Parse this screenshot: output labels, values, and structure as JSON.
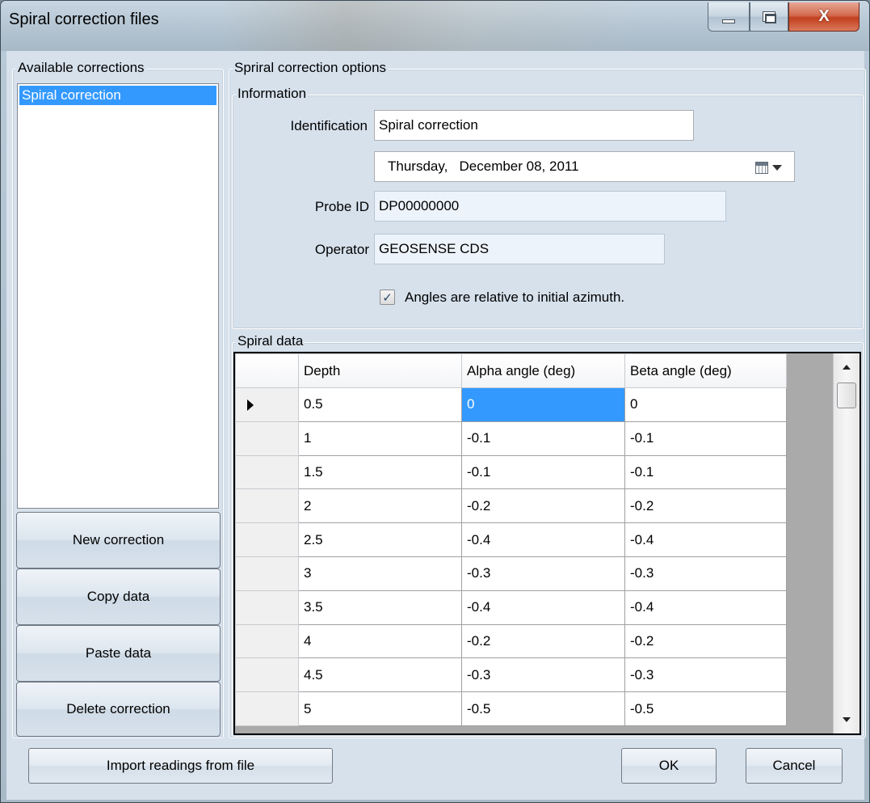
{
  "window": {
    "title": "Spiral correction files",
    "close_glyph": "X"
  },
  "left": {
    "group_label": "Available corrections",
    "items": [
      "Spiral correction"
    ],
    "buttons": {
      "new": "New correction",
      "copy": "Copy data",
      "paste": "Paste data",
      "delete": "Delete correction"
    }
  },
  "options": {
    "group_label": "Spriral correction options",
    "info": {
      "group_label": "Information",
      "identification_label": "Identification",
      "identification_value": "Spiral correction",
      "date_day": "Thursday",
      "date_rest": ",   December 08, 2011",
      "probe_label": "Probe ID",
      "probe_value": "DP00000000",
      "operator_label": "Operator",
      "operator_value": "GEOSENSE CDS",
      "checkbox_label": "Angles are relative to initial azimuth.",
      "checkbox_checked": true
    },
    "spiral": {
      "group_label": "Spiral data",
      "columns": [
        "Depth",
        "Alpha angle (deg)",
        "Beta angle (deg)"
      ],
      "rows": [
        [
          "0.5",
          "0",
          "0"
        ],
        [
          "1",
          "-0.1",
          "-0.1"
        ],
        [
          "1.5",
          "-0.1",
          "-0.1"
        ],
        [
          "2",
          "-0.2",
          "-0.2"
        ],
        [
          "2.5",
          "-0.4",
          "-0.4"
        ],
        [
          "3",
          "-0.3",
          "-0.3"
        ],
        [
          "3.5",
          "-0.4",
          "-0.4"
        ],
        [
          "4",
          "-0.2",
          "-0.2"
        ],
        [
          "4.5",
          "-0.3",
          "-0.3"
        ],
        [
          "5",
          "-0.5",
          "-0.5"
        ]
      ]
    }
  },
  "footer": {
    "import": "Import readings from file",
    "ok": "OK",
    "cancel": "Cancel"
  },
  "icons": {
    "calendar": "calendar-icon",
    "current_row": "row-pointer-icon"
  }
}
